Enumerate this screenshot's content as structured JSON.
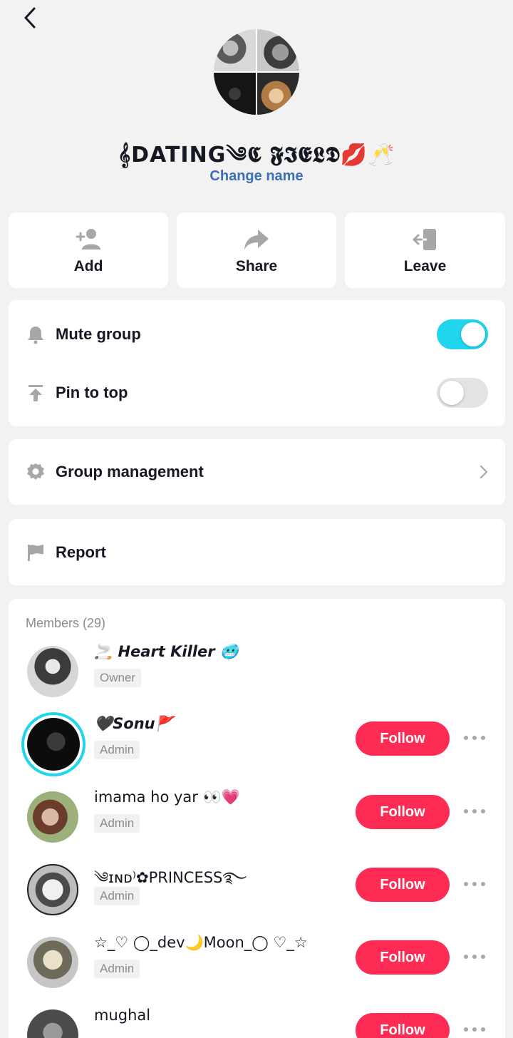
{
  "header": {
    "back_icon": "chevron-left-icon"
  },
  "group": {
    "name": "𝄞DATING༄𝕮 𝕱𝕴𝕰𝕷𝕯💋🥂",
    "change_name": "Change name"
  },
  "actions": [
    {
      "label": "Add",
      "icon": "add-user-icon"
    },
    {
      "label": "Share",
      "icon": "share-arrow-icon"
    },
    {
      "label": "Leave",
      "icon": "leave-icon"
    }
  ],
  "settings": {
    "mute": {
      "label": "Mute group",
      "icon": "bell-icon",
      "on": true
    },
    "pin": {
      "label": "Pin to top",
      "icon": "pin-top-icon",
      "on": false
    },
    "management": {
      "label": "Group management",
      "icon": "gear-icon"
    },
    "report": {
      "label": "Report",
      "icon": "flag-icon"
    }
  },
  "members": {
    "title": "Members (29)",
    "list": [
      {
        "name": "🚬 Heart Killer 🥶",
        "role": "Owner",
        "follow": ""
      },
      {
        "name": "🖤Sonu🚩",
        "role": "Admin",
        "follow": "Follow"
      },
      {
        "name": "imama ho yar 👀💗",
        "role": "Admin",
        "follow": "Follow"
      },
      {
        "name": "༄ɪɴᴅ⁾✿PRINCESS࿐",
        "role": "Admin",
        "follow": "Follow"
      },
      {
        "name": "☆_♡ ◯_dev🌙Moon_◯ ♡_☆",
        "role": "Admin",
        "follow": "Follow"
      },
      {
        "name": "mughal",
        "role": "",
        "follow": "Follow"
      }
    ]
  },
  "colors": {
    "accent": "#20d5ec",
    "follow": "#fe2c55",
    "link": "#3b6fb6"
  }
}
